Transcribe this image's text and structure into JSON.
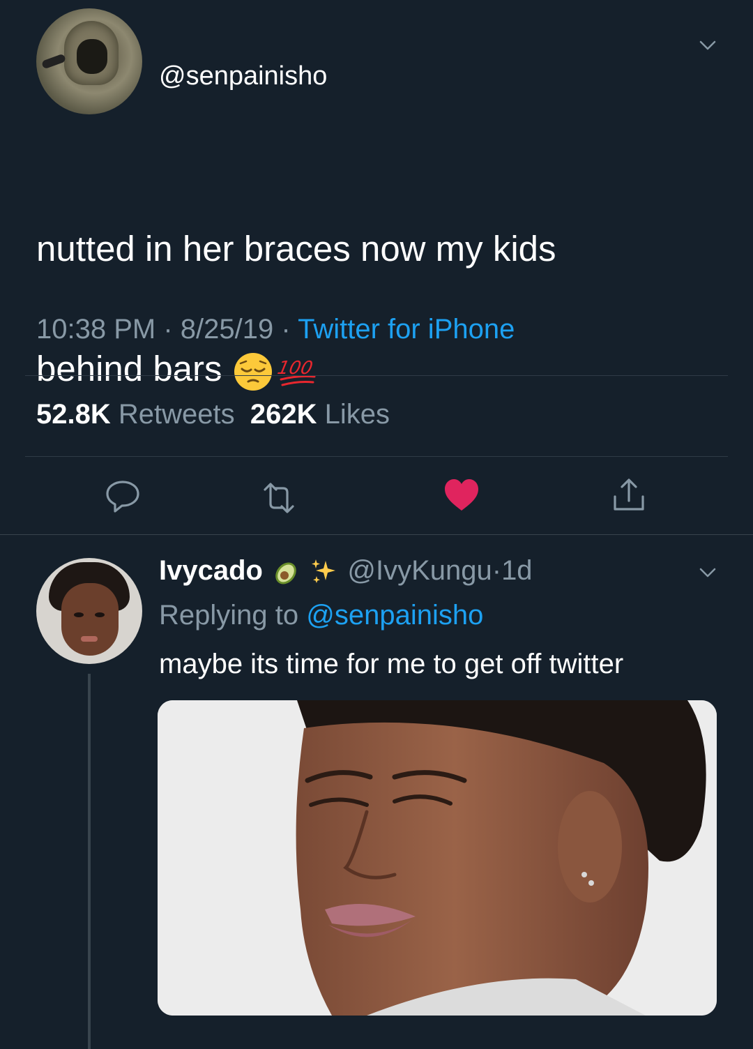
{
  "main_tweet": {
    "handle": "@senpainisho",
    "text_line1": "nutted in her braces now my kids",
    "text_line2": "behind bars",
    "emojis": [
      "pensive-face",
      "hundred-points"
    ],
    "time": "10:38 PM",
    "date": "8/25/19",
    "separator": "·",
    "source": "Twitter for iPhone",
    "retweet_count": "52.8K",
    "retweet_label": "Retweets",
    "like_count": "262K",
    "like_label": "Likes",
    "liked": true,
    "like_color": "#e0245e"
  },
  "reply": {
    "name": "Ivycado",
    "name_emojis": [
      "avocado",
      "sparkles"
    ],
    "handle": "@IvyKungu",
    "separator": "·",
    "age": "1d",
    "replying_label": "Replying to",
    "replying_to": "@senpainisho",
    "text": "maybe its time for me to get off twitter"
  },
  "colors": {
    "background": "#15202b",
    "primary_text": "#ffffff",
    "secondary_text": "#8899a6",
    "link": "#1da1f2",
    "divider": "#2f3b47"
  }
}
